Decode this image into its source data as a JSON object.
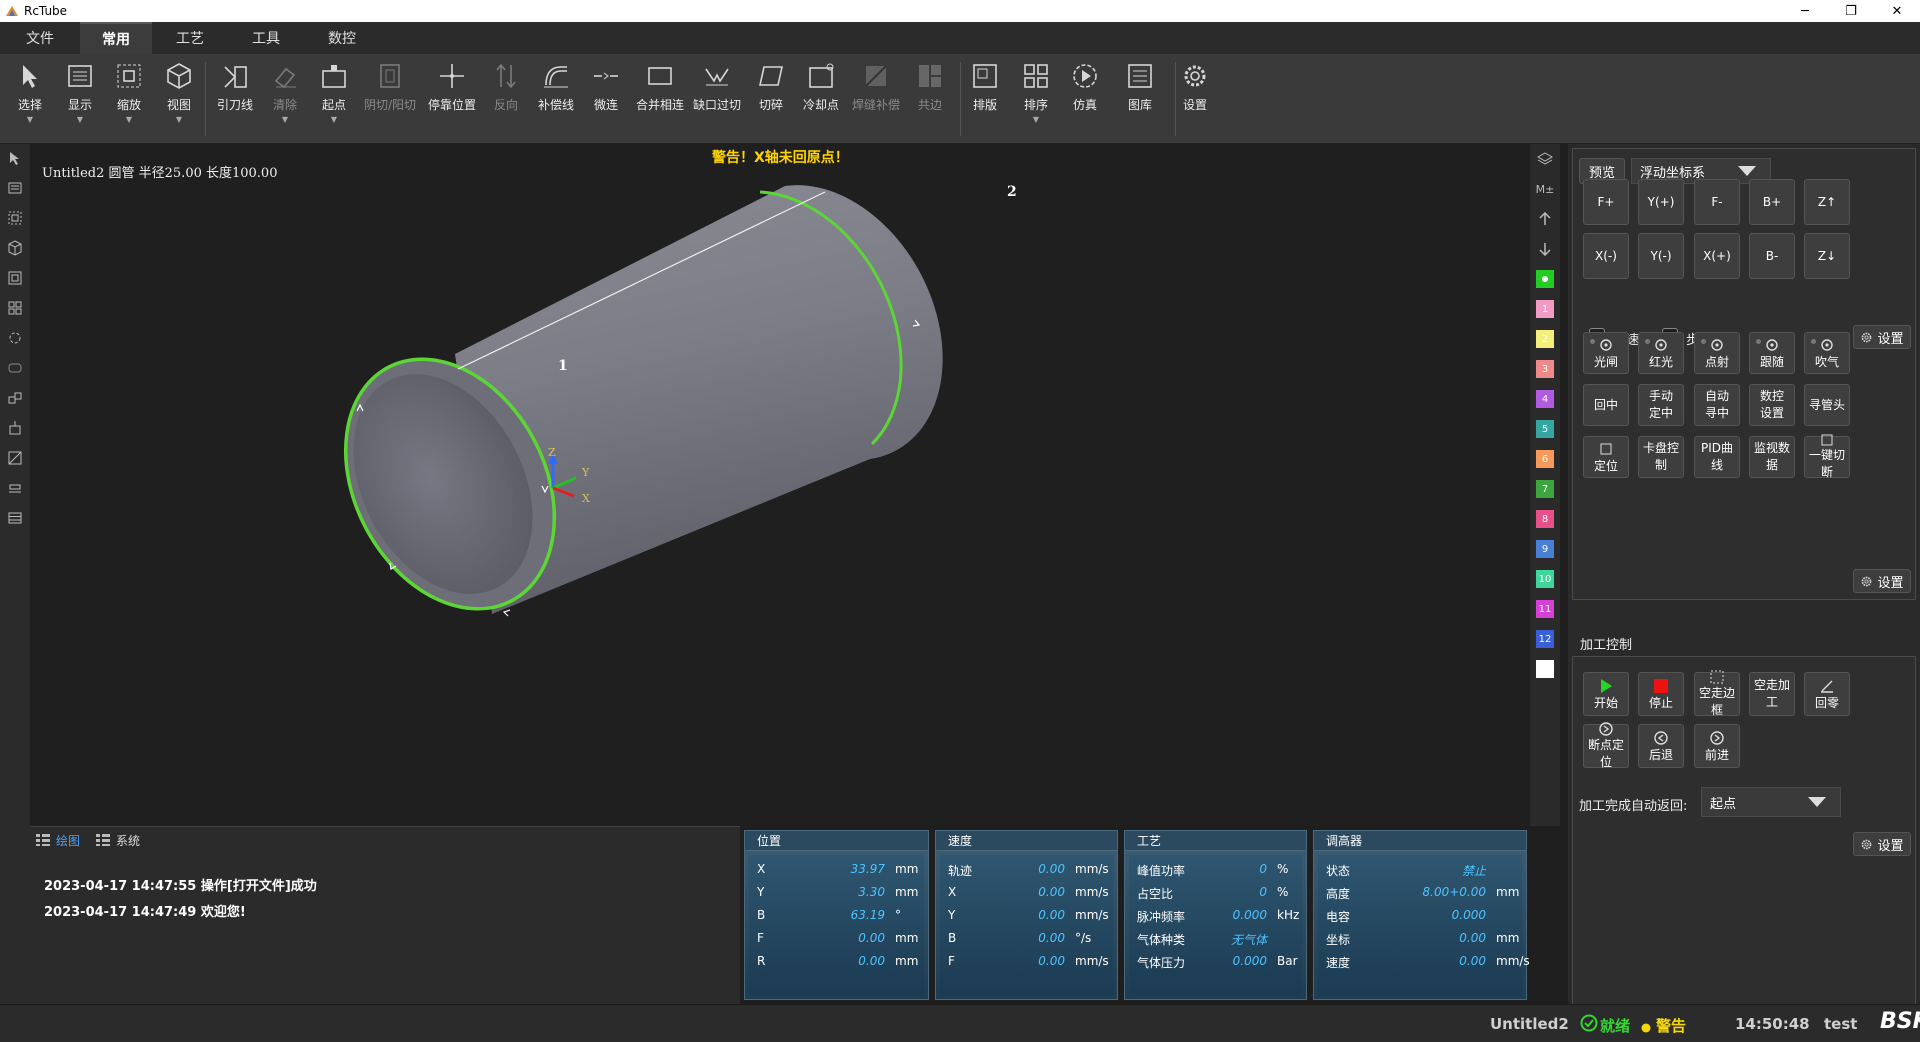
{
  "window": {
    "title": "RcTube",
    "min_label": "─",
    "max_label": "❐",
    "close_label": "✕"
  },
  "menu": {
    "tabs": [
      "文件",
      "常用",
      "工艺",
      "工具",
      "数控"
    ],
    "active": "常用"
  },
  "ribbon": {
    "tools": [
      {
        "label": "选择",
        "icon": "cursor-icon",
        "dropdown": true,
        "disabled": false
      },
      {
        "label": "显示",
        "icon": "display-icon",
        "dropdown": true,
        "disabled": false
      },
      {
        "label": "缩放",
        "icon": "zoom-icon",
        "dropdown": true,
        "disabled": false
      },
      {
        "label": "视图",
        "icon": "cube-view-icon",
        "dropdown": true,
        "disabled": false
      },
      {
        "label": "引刀线",
        "icon": "lead-line-icon",
        "dropdown": false,
        "disabled": false
      },
      {
        "label": "清除",
        "icon": "eraser-icon",
        "dropdown": true,
        "disabled": true
      },
      {
        "label": "起点",
        "icon": "start-point-icon",
        "dropdown": true,
        "disabled": false
      },
      {
        "label": "阴切/阳切",
        "icon": "inner-outer-cut-icon",
        "dropdown": false,
        "disabled": true
      },
      {
        "label": "停靠位置",
        "icon": "dock-position-icon",
        "dropdown": false,
        "disabled": false
      },
      {
        "label": "反向",
        "icon": "reverse-icon",
        "dropdown": false,
        "disabled": true
      },
      {
        "label": "补偿线",
        "icon": "compensation-line-icon",
        "dropdown": false,
        "disabled": false
      },
      {
        "label": "微连",
        "icon": "micro-joint-icon",
        "dropdown": false,
        "disabled": false
      },
      {
        "label": "合并相连",
        "icon": "merge-icon",
        "dropdown": false,
        "disabled": false
      },
      {
        "label": "缺口过切",
        "icon": "notch-overcut-icon",
        "dropdown": false,
        "disabled": false
      },
      {
        "label": "切碎",
        "icon": "shred-icon",
        "dropdown": false,
        "disabled": false
      },
      {
        "label": "冷却点",
        "icon": "cooling-point-icon",
        "dropdown": false,
        "disabled": false
      },
      {
        "label": "焊缝补偿",
        "icon": "weld-compensation-icon",
        "dropdown": false,
        "disabled": true
      },
      {
        "label": "共边",
        "icon": "common-edge-icon",
        "dropdown": false,
        "disabled": true
      },
      {
        "label": "排版",
        "icon": "layout-icon",
        "dropdown": false,
        "disabled": false
      },
      {
        "label": "排序",
        "icon": "sort-icon",
        "dropdown": true,
        "disabled": false
      },
      {
        "label": "仿真",
        "icon": "simulation-icon",
        "dropdown": false,
        "disabled": false
      },
      {
        "label": "图库",
        "icon": "library-icon",
        "dropdown": false,
        "disabled": false
      },
      {
        "label": "设置",
        "icon": "gear-icon",
        "dropdown": false,
        "disabled": false
      }
    ]
  },
  "canvas": {
    "doc_info": "Untitled2 圆管 半径25.00 长度100.00",
    "warning": "警告！X轴未回原点！",
    "point_labels": [
      "1",
      "2"
    ],
    "axes": [
      "X",
      "Y",
      "Z"
    ],
    "highlight_color": "#5cd635"
  },
  "layers": {
    "top_labels": [
      "M±"
    ],
    "items": [
      {
        "label": "",
        "color": "#22cc22"
      },
      {
        "label": "1",
        "color": "#f29bc4"
      },
      {
        "label": "2",
        "color": "#f3ef7a"
      },
      {
        "label": "3",
        "color": "#f08a8a"
      },
      {
        "label": "4",
        "color": "#b05be0"
      },
      {
        "label": "5",
        "color": "#36a6a0"
      },
      {
        "label": "6",
        "color": "#f59a5a"
      },
      {
        "label": "7",
        "color": "#3ea640"
      },
      {
        "label": "8",
        "color": "#e8508a"
      },
      {
        "label": "9",
        "color": "#4a7fd6"
      },
      {
        "label": "10",
        "color": "#3ed69a"
      },
      {
        "label": "11",
        "color": "#d640d6"
      },
      {
        "label": "12",
        "color": "#3a5fd6"
      },
      {
        "label": "",
        "color": "#ffffff"
      }
    ]
  },
  "control": {
    "preview": "预览",
    "coord_system": "浮动坐标系",
    "jog_row1": [
      "F+",
      "Y(+)",
      "F-",
      "B+",
      "Z↑"
    ],
    "jog_row2": [
      "X(-)",
      "Y(-)",
      "X(+)",
      "B-",
      "Z↓"
    ],
    "fast": "快速",
    "step": "步进",
    "settings": "设置",
    "func_row1": [
      "光闸",
      "红光",
      "点射",
      "跟随",
      "吹气"
    ],
    "func_row2": [
      "回中",
      "手动\n定中",
      "自动\n寻中",
      "数控\n设置",
      "寻管头"
    ],
    "func_row3": [
      "定位",
      "卡盘控制",
      "PID曲线",
      "监视数据",
      "一键切断"
    ],
    "process_title": "加工控制",
    "proc_row1": [
      "开始",
      "停止",
      "空走边框",
      "空走加工",
      "回零"
    ],
    "proc_row2": [
      "断点定位",
      "后退",
      "前进"
    ],
    "auto_return_label": "加工完成自动返回:",
    "auto_return_value": "起点"
  },
  "log": {
    "tabs": [
      "绘图",
      "系统"
    ],
    "lines": [
      "2023-04-17 14:47:55 操作[打开文件]成功",
      "2023-04-17 14:47:49 欢迎您!"
    ]
  },
  "position": {
    "title": "位置",
    "rows": [
      {
        "k": "X",
        "v": "33.97",
        "u": "mm"
      },
      {
        "k": "Y",
        "v": "3.30",
        "u": "mm"
      },
      {
        "k": "B",
        "v": "63.19",
        "u": "°"
      },
      {
        "k": "F",
        "v": "0.00",
        "u": "mm"
      },
      {
        "k": "R",
        "v": "0.00",
        "u": "mm"
      }
    ]
  },
  "speed": {
    "title": "速度",
    "rows": [
      {
        "k": "轨迹",
        "v": "0.00",
        "u": "mm/s"
      },
      {
        "k": "X",
        "v": "0.00",
        "u": "mm/s"
      },
      {
        "k": "Y",
        "v": "0.00",
        "u": "mm/s"
      },
      {
        "k": "B",
        "v": "0.00",
        "u": "°/s"
      },
      {
        "k": "F",
        "v": "0.00",
        "u": "mm/s"
      }
    ]
  },
  "craft": {
    "title": "工艺",
    "rows": [
      {
        "k": "峰值功率",
        "v": "0",
        "u": "%"
      },
      {
        "k": "占空比",
        "v": "0",
        "u": "%"
      },
      {
        "k": "脉冲频率",
        "v": "0.000",
        "u": "kHz"
      },
      {
        "k": "气体种类",
        "v": "无气体",
        "u": ""
      },
      {
        "k": "气体压力",
        "v": "0.000",
        "u": "Bar"
      }
    ]
  },
  "regulator": {
    "title": "调高器",
    "rows": [
      {
        "k": "状态",
        "v": "禁止",
        "u": ""
      },
      {
        "k": "高度",
        "v": "8.00+0.00",
        "u": "mm"
      },
      {
        "k": "电容",
        "v": "0.000",
        "u": ""
      },
      {
        "k": "坐标",
        "v": "0.00",
        "u": "mm"
      },
      {
        "k": "速度",
        "v": "0.00",
        "u": "mm/s"
      }
    ]
  },
  "statusbar": {
    "file": "Untitled2",
    "ready": "就绪",
    "warn": "警告",
    "time": "14:50:48",
    "user": "test",
    "brand": "BSK"
  }
}
